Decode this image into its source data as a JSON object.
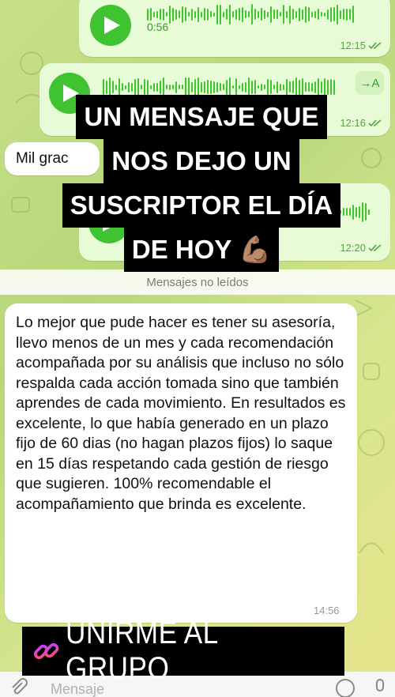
{
  "voice_messages": [
    {
      "duration": "0:56",
      "time": "12:15"
    },
    {
      "time": "12:16",
      "transcribe_label": "→A"
    },
    {
      "time": "12:20"
    }
  ],
  "partial_incoming_text": "Mil grac",
  "unread_divider": "Mensajes no leídos",
  "incoming_message": {
    "text": "Lo mejor que pude hacer es tener su asesoría, llevo menos de un mes y cada recomendación acompañada por su análisis que incluso no sólo respalda cada acción tomada sino que también aprendes de cada movimiento. En resultados es excelente, lo que había generado en un plazo fijo de 60 dias (no hagan plazos fijos) lo saque en 15 días respetando cada gestión de riesgo que sugieren. 100% recomendable el acompañamiento que brinda es excelente.",
    "time": "14:56"
  },
  "overlay": {
    "lines": [
      "UN MENSAJE QUE",
      "NOS DEJO UN",
      "SUSCRIPTOR EL DÍA",
      "DE HOY 💪🏽"
    ]
  },
  "cta": {
    "label": "UNIRME AL GRUPO",
    "icon": "link-icon",
    "color": "#ff3b6b"
  },
  "input": {
    "placeholder": "Mensaje"
  },
  "colors": {
    "accent_green": "#3fc330",
    "out_bubble": "#e7fbd6"
  }
}
